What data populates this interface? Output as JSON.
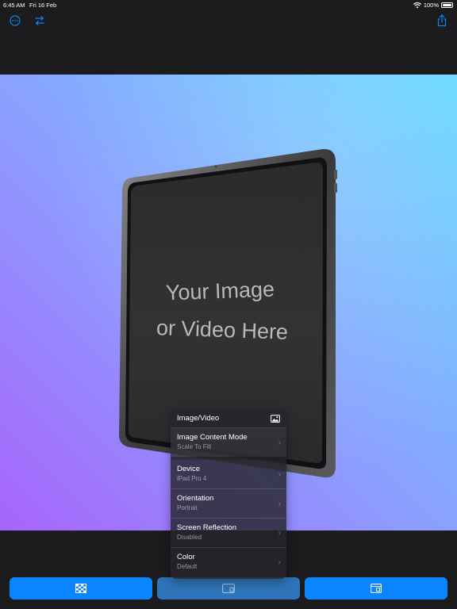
{
  "status_bar": {
    "time": "6:45 AM",
    "date": "Fri 16 Feb",
    "battery": "100%",
    "wifi_icon": "wifi-icon"
  },
  "toolbar": {
    "more_icon": "ellipsis-circle-icon",
    "swap_icon": "arrows-swap-icon",
    "share_icon": "share-icon",
    "accent": "#0a84ff"
  },
  "device_preview": {
    "placeholder_line1": "Your Image",
    "placeholder_line2": "or Video Here"
  },
  "menu": {
    "header": "Image/Video",
    "header_icon": "photo-icon",
    "items": [
      {
        "title": "Image Content Mode",
        "subtitle": "Scale To Fill"
      },
      {
        "title": "Device",
        "subtitle": "iPad Pro 4"
      },
      {
        "title": "Orientation",
        "subtitle": "Portrait"
      },
      {
        "title": "Screen Reflection",
        "subtitle": "Disabled"
      },
      {
        "title": "Color",
        "subtitle": "Default"
      }
    ]
  },
  "bottom_buttons": [
    {
      "icon": "checkerboard-icon"
    },
    {
      "icon": "device-icon"
    },
    {
      "icon": "layout-icon"
    }
  ],
  "colors": {
    "background": "#1c1c1e",
    "gradient_start": "#a864fb",
    "gradient_end": "#62d9ff",
    "button": "#0a84ff"
  }
}
